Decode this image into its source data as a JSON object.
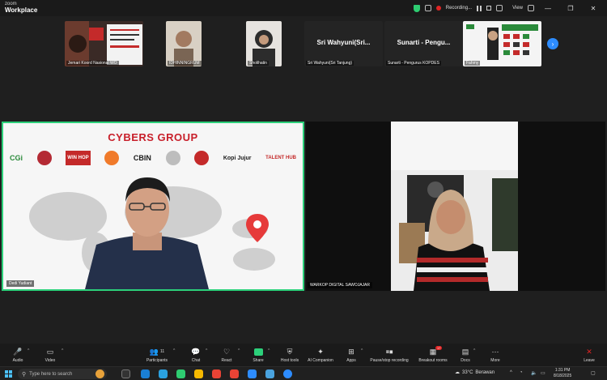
{
  "window": {
    "brand_small": "zoom",
    "brand_title": "Workplace",
    "recording_label": "Recording...",
    "view_label": "View",
    "minimize": "—",
    "maximize": "❐",
    "close": "✕"
  },
  "thumbnails": [
    {
      "caption": "Jemari Koord Nasional WO"
    },
    {
      "caption": "IDHINNINGRUM"
    },
    {
      "caption": "Sholihatin"
    },
    {
      "caption": "Sri Wahyuni(Sri Tanjung)",
      "big_name": "Sri  Wahyuni(Sri..."
    },
    {
      "caption": "Sunarti - Pengurus KOPDES",
      "big_name": "Sunarti  -  Pengu..."
    },
    {
      "caption": "Fahmy"
    }
  ],
  "main_left": {
    "slide_title": "CYBERS GROUP",
    "logos": [
      "CGi",
      "BROTHERS",
      "WIN HOP",
      "CYBERS ACADEMY",
      "CBIN",
      "CYBERS 11",
      "KOPIBLOCKCHAIN",
      "Kopi Jujur",
      "TALENT HUB"
    ],
    "name": "Dedi Yudiant"
  },
  "main_right": {
    "name": "WARKOP DIGITAL SAWOJAJAR"
  },
  "toolbar": {
    "audio": "Audio",
    "video": "Video",
    "participants": "Participants",
    "participants_count": "11",
    "chat": "Chat",
    "react": "React",
    "share": "Share",
    "host_tools": "Host tools",
    "ai_companion": "AI Companion",
    "apps": "Apps",
    "pause_stop": "Pause/stop recording",
    "breakout": "Breakout rooms",
    "breakout_badge": "17",
    "docs": "Docs",
    "more": "More",
    "leave": "Leave"
  },
  "taskbar": {
    "search_placeholder": "Type here to search",
    "weather_temp": "33°C",
    "weather_desc": "Berawan",
    "time": "1:31 PM",
    "date": "8/18/2025"
  },
  "colors": {
    "accent": "#2d8cff",
    "active_speaker": "#2cd07a",
    "record": "#e02424",
    "brand_red": "#c81f2a"
  }
}
